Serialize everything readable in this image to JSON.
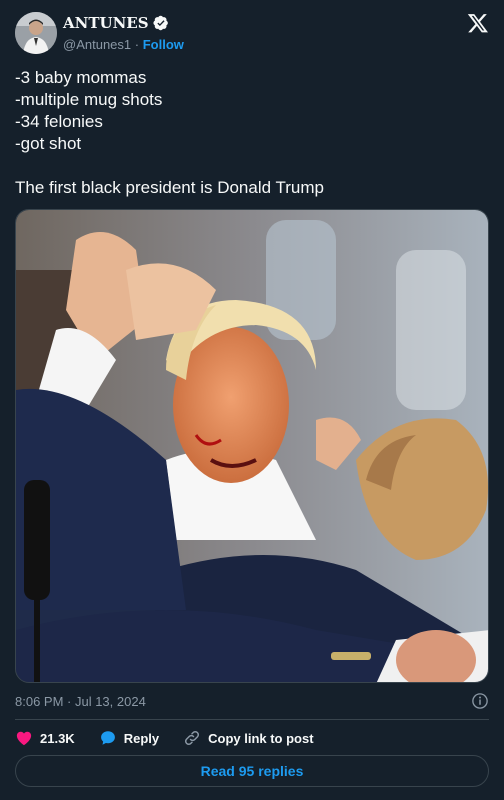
{
  "author": {
    "display_name": "ANTUNES",
    "handle": "@Antunes1",
    "separator": "·",
    "follow_label": "Follow",
    "verified": true
  },
  "tweet": {
    "lines": [
      "-3 baby mommas",
      "-multiple mug shots",
      "-34 felonies",
      "-got shot",
      "",
      "The first black president is Donald Trump"
    ],
    "timestamp": "8:06 PM · Jul 13, 2024"
  },
  "actions": {
    "likes": "21.3K",
    "reply_label": "Reply",
    "copy_link_label": "Copy link to post"
  },
  "read_replies_label": "Read 95 replies",
  "colors": {
    "background": "#15202b",
    "accent": "#1d9bf0",
    "heart": "#f91880",
    "muted": "#8b98a5",
    "border": "#38444d"
  },
  "icons": [
    "verified-badge-icon",
    "x-logo-icon",
    "info-icon",
    "heart-icon",
    "reply-bubble-icon",
    "link-icon"
  ]
}
